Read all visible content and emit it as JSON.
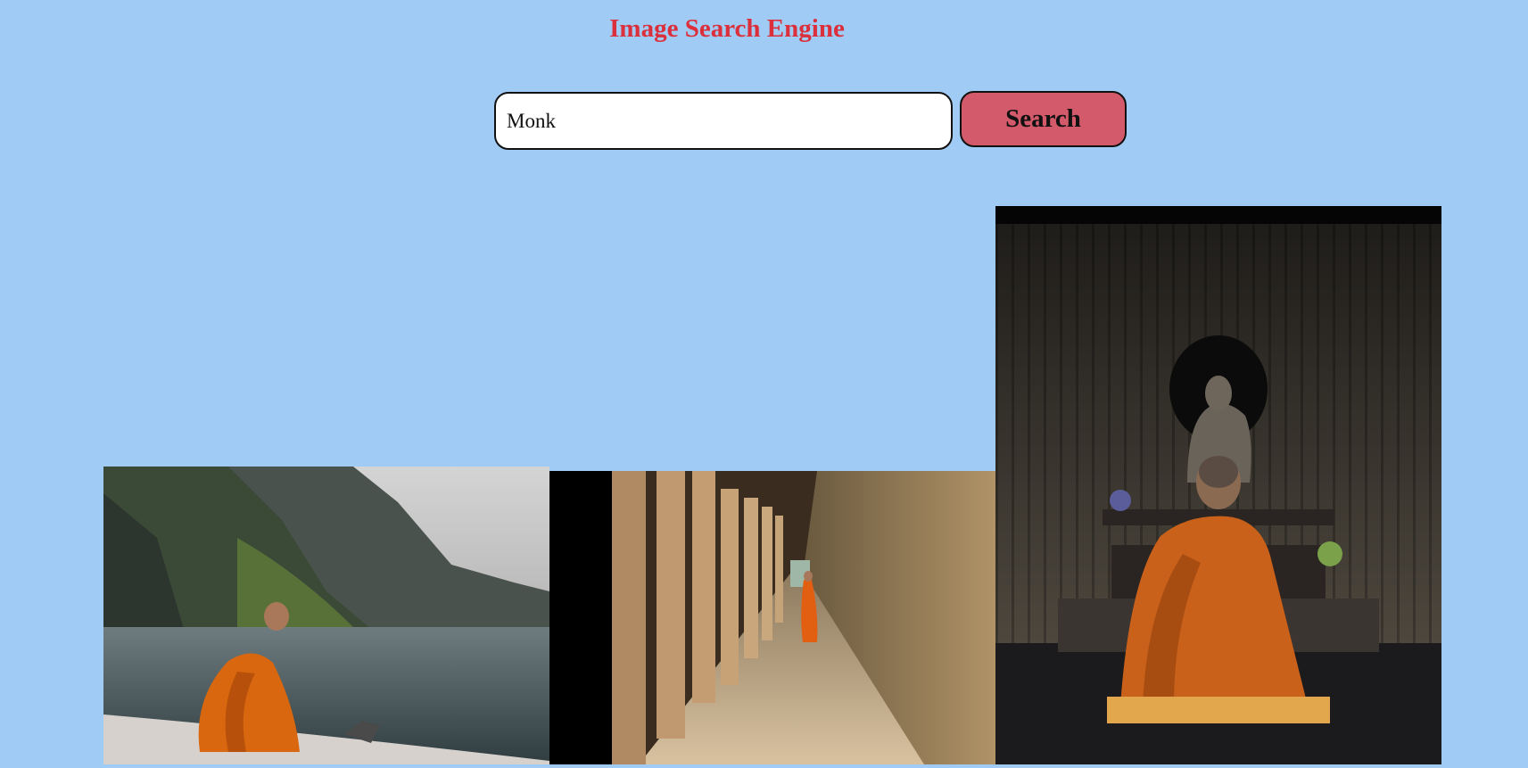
{
  "header": {
    "title": "Image Search Engine"
  },
  "search": {
    "value": "Monk",
    "button_label": "Search"
  },
  "results": [
    {
      "subject": "monk-by-lake-image"
    },
    {
      "subject": "monk-in-temple-corridor-image"
    },
    {
      "subject": "monk-before-buddha-statue-image"
    }
  ],
  "colors": {
    "background": "#a0cbf4",
    "title": "#dc2f3c",
    "button": "#d35a6a",
    "robe": "#d9670f"
  }
}
